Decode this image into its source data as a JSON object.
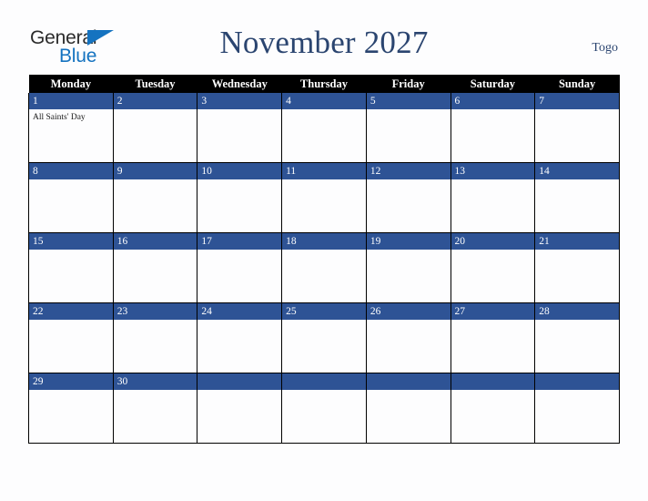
{
  "brand": {
    "name_part1": "General",
    "name_part2": "Blue",
    "triangle_icon": "blue-triangle-icon",
    "color_dark": "#2b2b2b",
    "color_blue": "#1573c0"
  },
  "header": {
    "title": "November 2027",
    "country": "Togo",
    "title_color": "#2b4570"
  },
  "calendar": {
    "accent_color": "#2e5395",
    "header_bg": "#000000",
    "weekdays": [
      "Monday",
      "Tuesday",
      "Wednesday",
      "Thursday",
      "Friday",
      "Saturday",
      "Sunday"
    ],
    "weeks": [
      [
        {
          "date": "1",
          "events": [
            "All Saints' Day"
          ]
        },
        {
          "date": "2",
          "events": []
        },
        {
          "date": "3",
          "events": []
        },
        {
          "date": "4",
          "events": []
        },
        {
          "date": "5",
          "events": []
        },
        {
          "date": "6",
          "events": []
        },
        {
          "date": "7",
          "events": []
        }
      ],
      [
        {
          "date": "8",
          "events": []
        },
        {
          "date": "9",
          "events": []
        },
        {
          "date": "10",
          "events": []
        },
        {
          "date": "11",
          "events": []
        },
        {
          "date": "12",
          "events": []
        },
        {
          "date": "13",
          "events": []
        },
        {
          "date": "14",
          "events": []
        }
      ],
      [
        {
          "date": "15",
          "events": []
        },
        {
          "date": "16",
          "events": []
        },
        {
          "date": "17",
          "events": []
        },
        {
          "date": "18",
          "events": []
        },
        {
          "date": "19",
          "events": []
        },
        {
          "date": "20",
          "events": []
        },
        {
          "date": "21",
          "events": []
        }
      ],
      [
        {
          "date": "22",
          "events": []
        },
        {
          "date": "23",
          "events": []
        },
        {
          "date": "24",
          "events": []
        },
        {
          "date": "25",
          "events": []
        },
        {
          "date": "26",
          "events": []
        },
        {
          "date": "27",
          "events": []
        },
        {
          "date": "28",
          "events": []
        }
      ],
      [
        {
          "date": "29",
          "events": []
        },
        {
          "date": "30",
          "events": []
        },
        {
          "date": "",
          "events": []
        },
        {
          "date": "",
          "events": []
        },
        {
          "date": "",
          "events": []
        },
        {
          "date": "",
          "events": []
        },
        {
          "date": "",
          "events": []
        }
      ]
    ]
  }
}
